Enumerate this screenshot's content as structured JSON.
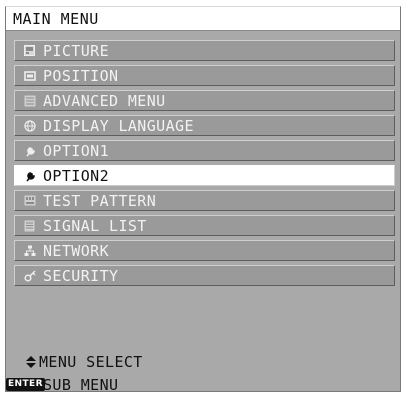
{
  "menu": {
    "title": "MAIN MENU",
    "items": [
      {
        "label": "PICTURE",
        "icon": "picture-icon"
      },
      {
        "label": "POSITION",
        "icon": "position-icon"
      },
      {
        "label": "ADVANCED MENU",
        "icon": "advanced-menu-icon"
      },
      {
        "label": "DISPLAY LANGUAGE",
        "icon": "globe-icon"
      },
      {
        "label": "OPTION1",
        "icon": "wrench-icon"
      },
      {
        "label": "OPTION2",
        "icon": "wrench-icon",
        "selected": true
      },
      {
        "label": "TEST PATTERN",
        "icon": "test-pattern-icon"
      },
      {
        "label": "SIGNAL LIST",
        "icon": "signal-list-icon"
      },
      {
        "label": "NETWORK",
        "icon": "network-icon"
      },
      {
        "label": "SECURITY",
        "icon": "key-icon"
      }
    ]
  },
  "footer": {
    "select_label": "MENU SELECT",
    "enter_key_label": "ENTER",
    "sub_label": "SUB MENU"
  },
  "colors": {
    "panel_background": "#a9a9a9",
    "item_background": "#9a9a9a",
    "item_text": "#f2f2f2",
    "selected_background": "#ffffff",
    "selected_text": "#111111"
  }
}
